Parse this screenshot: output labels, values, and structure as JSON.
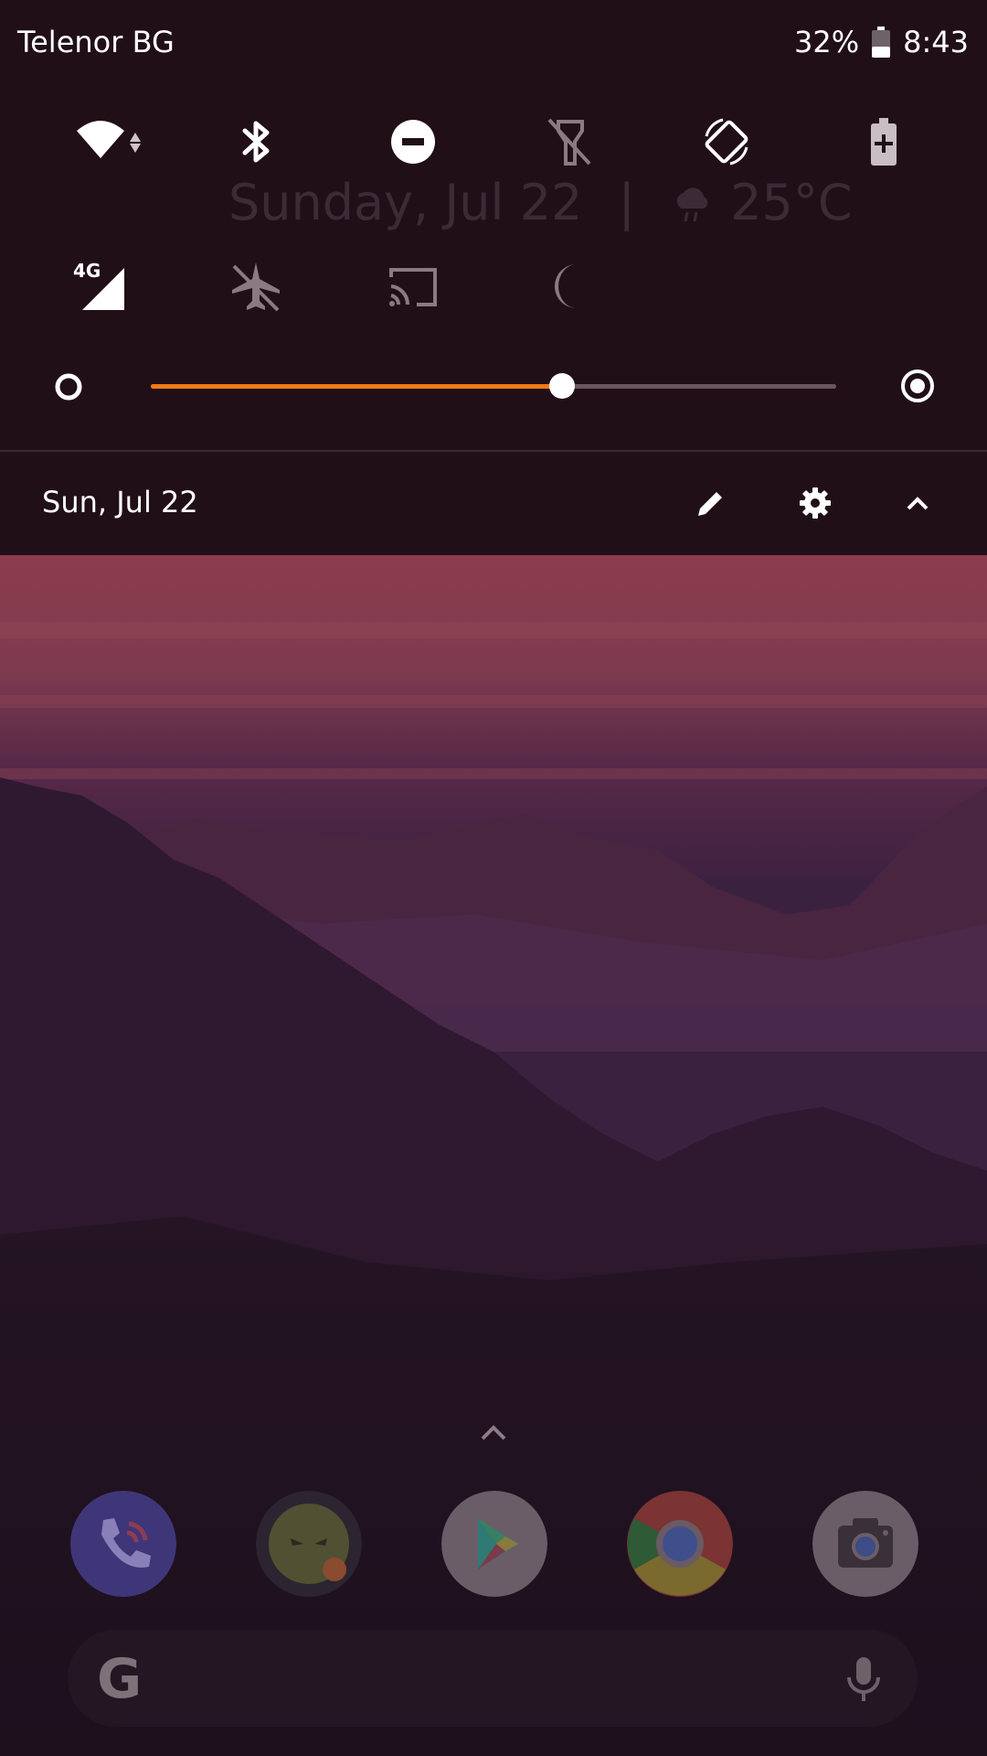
{
  "status_bar": {
    "carrier": "Telenor BG",
    "battery_percent": "32%",
    "time": "8:43",
    "battery_icon": "battery-icon"
  },
  "quick_settings": {
    "tiles_row1": [
      {
        "name": "wifi",
        "icon": "wifi-icon",
        "active": true
      },
      {
        "name": "bluetooth",
        "icon": "bluetooth-icon",
        "active": true
      },
      {
        "name": "do-not-disturb",
        "icon": "do-not-disturb-icon",
        "active": true
      },
      {
        "name": "flashlight",
        "icon": "flashlight-off-icon",
        "active": false
      },
      {
        "name": "auto-rotate",
        "icon": "auto-rotate-icon",
        "active": true
      },
      {
        "name": "battery-saver",
        "icon": "battery-saver-icon",
        "active": false
      }
    ],
    "tiles_row2": [
      {
        "name": "mobile-data",
        "icon": "signal-4g-icon",
        "badge": "4G",
        "active": true
      },
      {
        "name": "airplane-mode",
        "icon": "airplane-off-icon",
        "active": false
      },
      {
        "name": "cast",
        "icon": "cast-icon",
        "active": false
      },
      {
        "name": "night-light",
        "icon": "moon-icon",
        "active": false
      }
    ],
    "brightness": {
      "level_fraction": 0.6,
      "accent_color": "#f07a17",
      "low_icon": "brightness-low-icon",
      "high_icon": "brightness-high-icon"
    },
    "footer": {
      "date": "Sun, Jul 22",
      "edit_icon": "pencil-icon",
      "settings_icon": "gear-icon",
      "collapse_icon": "chevron-up-icon"
    }
  },
  "background_widget": {
    "date": "Sunday, Jul 22",
    "separator": "|",
    "temperature": "25°C",
    "weather_icon": "rain-cloud-icon"
  },
  "home": {
    "dock_apps": [
      "Phone",
      "Orfox",
      "Play Store",
      "Chrome",
      "Camera"
    ],
    "search_logo": "G"
  }
}
